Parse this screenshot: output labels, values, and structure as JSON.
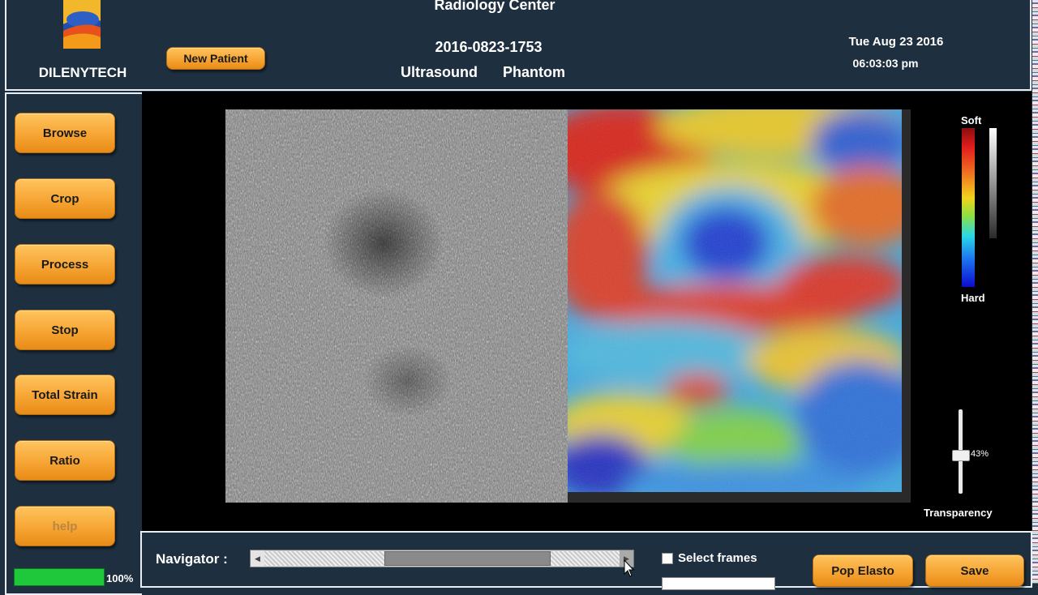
{
  "header": {
    "title": "Radiology Center",
    "brand": "DILENYTECH",
    "new_patient": "New Patient",
    "patient_id": "2016-0823-1753",
    "modality": "Ultrasound",
    "subject": "Phantom",
    "date": "Tue Aug 23 2016",
    "time": "06:03:03 pm"
  },
  "sidebar": {
    "buttons": [
      {
        "label": "Browse"
      },
      {
        "label": "Crop"
      },
      {
        "label": "Process"
      },
      {
        "label": "Stop"
      },
      {
        "label": "Total Strain"
      },
      {
        "label": "Ratio"
      },
      {
        "label": "help"
      }
    ],
    "progress_label": "100%",
    "progress_fraction": 1.0
  },
  "colorbar": {
    "top_label": "Soft",
    "bottom_label": "Hard"
  },
  "transparency": {
    "label": "Transparency",
    "value_label": "43%",
    "value_fraction": 0.43
  },
  "bottom": {
    "navigator_label": "Navigator :",
    "select_frames": "Select frames",
    "pop_elasto": "Pop Elasto",
    "save": "Save"
  },
  "colors": {
    "button_orange": "#f5a230",
    "panel_bg": "#1e2f3f",
    "progress_green": "#1fc73b"
  },
  "icons": [
    "logo-icon",
    "scroll-left-icon",
    "scroll-right-icon",
    "checkbox-icon",
    "mouse-cursor-icon"
  ]
}
